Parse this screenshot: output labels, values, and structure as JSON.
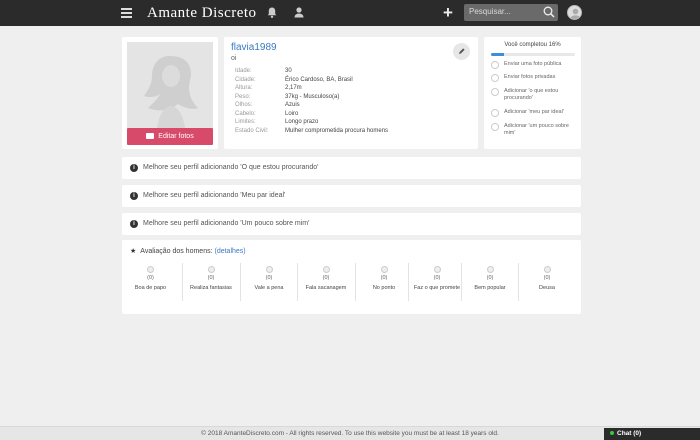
{
  "header": {
    "logo": "Amante Discreto",
    "search_placeholder": "Pesquisar...",
    "icons": [
      "menu-icon",
      "bell-icon",
      "user-icon",
      "plus-icon",
      "search-icon",
      "avatar"
    ]
  },
  "profile": {
    "username": "flavia1989",
    "status": "oi",
    "edit_photos_label": "Editar fotos",
    "fields": [
      {
        "key": "Idade:",
        "value": "30"
      },
      {
        "key": "Cidade:",
        "value": "Érico Cardoso, BA, Brasil"
      },
      {
        "key": "Altura:",
        "value": "2,17m"
      },
      {
        "key": "Peso:",
        "value": "37kg - Musculoso(a)"
      },
      {
        "key": "Olhos:",
        "value": "Azuis"
      },
      {
        "key": "Cabelo:",
        "value": "Loiro"
      },
      {
        "key": "Limites:",
        "value": "Longo prazo"
      },
      {
        "key": "Estado Civil:",
        "value": "Mulher comprometida procura homens"
      }
    ]
  },
  "progress": {
    "title": "Você completou 16%",
    "percent": 16,
    "tasks": [
      "Enviar uma foto pública",
      "Enviar fotos privadas",
      "Adicionar 'o que estou procurando'",
      "Adicionar 'meu par ideal'",
      "Adicionar 'um pouco sobre mim'"
    ]
  },
  "tips": [
    "Melhore seu perfil adicionando 'O que estou procurando'",
    "Melhore seu perfil adicionando 'Meu par ideal'",
    "Melhore seu perfil adicionando 'Um pouco sobre mim'"
  ],
  "ratings": {
    "title": "Avaliação dos homens:",
    "details_link": "(detalhes)",
    "items": [
      {
        "count": "(0)",
        "label": "Boa de papo"
      },
      {
        "count": "(0)",
        "label": "Realiza fantasias"
      },
      {
        "count": "(0)",
        "label": "Vale a pena"
      },
      {
        "count": "(0)",
        "label": "Fala sacanagem"
      },
      {
        "count": "(0)",
        "label": "No ponto"
      },
      {
        "count": "(0)",
        "label": "Faz o que promete"
      },
      {
        "count": "(0)",
        "label": "Bem popular"
      },
      {
        "count": "(0)",
        "label": "Deusa"
      }
    ]
  },
  "footer": {
    "text": "© 2018 AmanteDiscreto.com - All rights reserved. To use this website you must be at least 18 years old.",
    "chat_label": "Chat (0)"
  },
  "colors": {
    "topbar": "#2b2b2b",
    "accent_pink": "#d84a6a",
    "link_blue": "#3a7bbf",
    "progress_blue": "#3a8fd8"
  }
}
